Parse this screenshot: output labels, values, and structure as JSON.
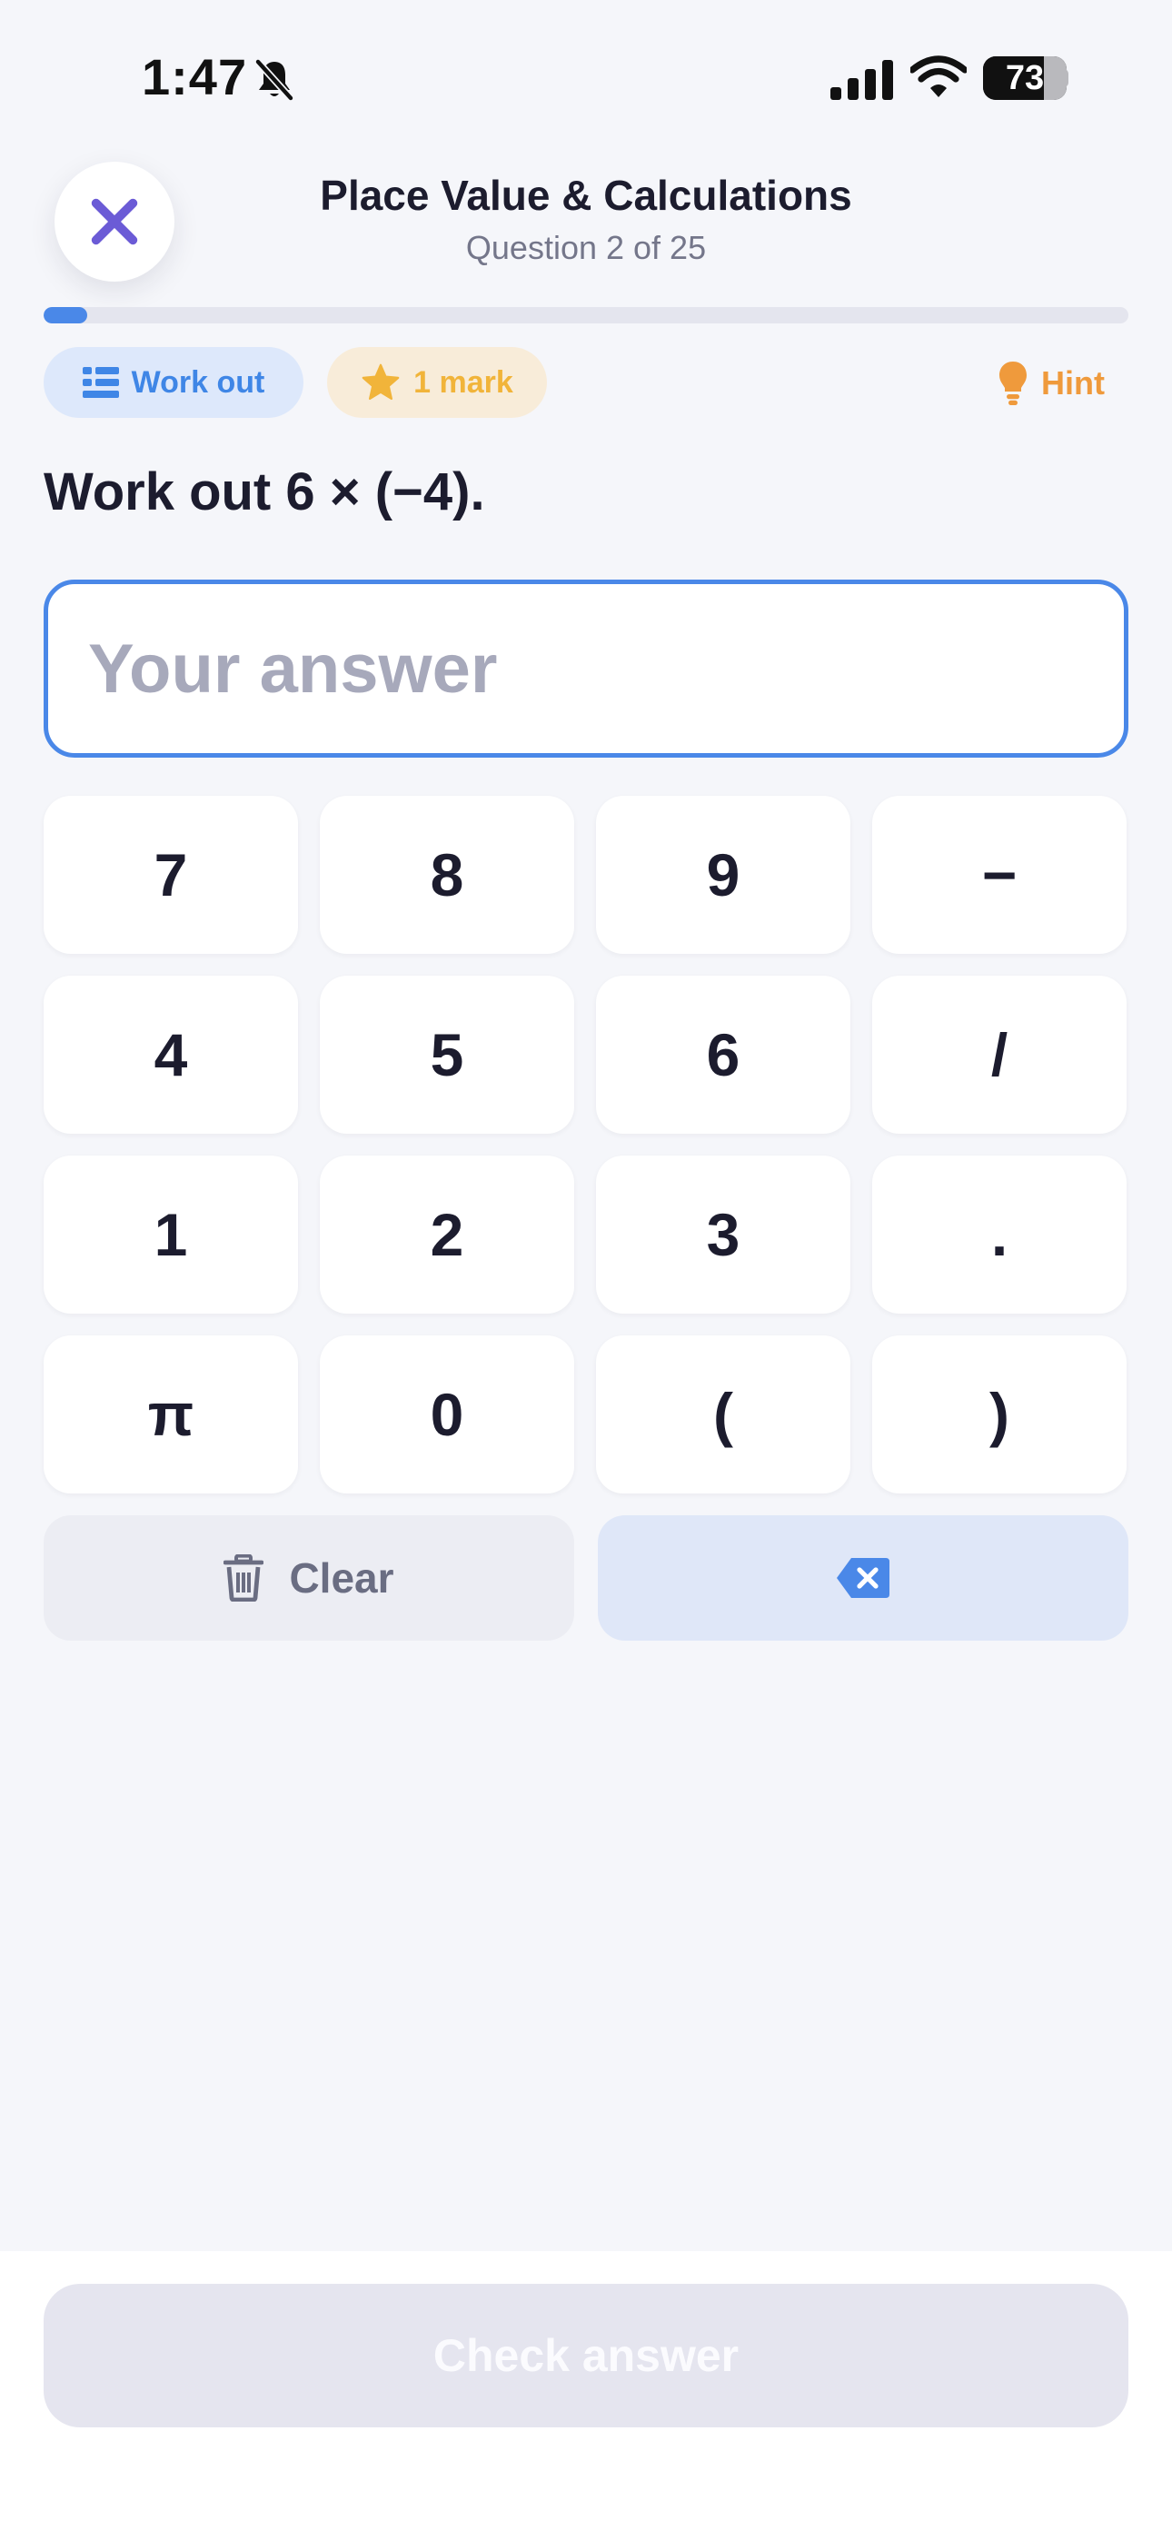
{
  "status_bar": {
    "time": "1:47",
    "battery_level": "73",
    "battery_percent": 73
  },
  "header": {
    "title": "Place Value & Calculations",
    "question_counter": "Question 2 of 25",
    "progress_fraction": 0.04
  },
  "tags": {
    "type_label": "Work out",
    "marks_label": "1 mark",
    "hint_label": "Hint"
  },
  "question": {
    "text": "Work out 6 × (−4)."
  },
  "answer": {
    "value": "",
    "placeholder": "Your answer"
  },
  "keypad": {
    "keys": [
      "7",
      "8",
      "9",
      "−",
      "4",
      "5",
      "6",
      "/",
      "1",
      "2",
      "3",
      ".",
      "π",
      "0",
      "(",
      ")"
    ]
  },
  "actions": {
    "clear_label": "Clear",
    "check_label": "Check answer"
  },
  "icons": {
    "close": "close-icon",
    "list": "list-icon",
    "star": "star-icon",
    "hint": "lightbulb-icon",
    "trash": "trash-icon",
    "backspace": "backspace-icon"
  },
  "colors": {
    "accent_blue": "#4a88e8",
    "close_purple": "#6b5bd6",
    "marks_gold": "#f1b43a",
    "hint_orange": "#ef9a3c",
    "background": "#f5f6fa"
  }
}
